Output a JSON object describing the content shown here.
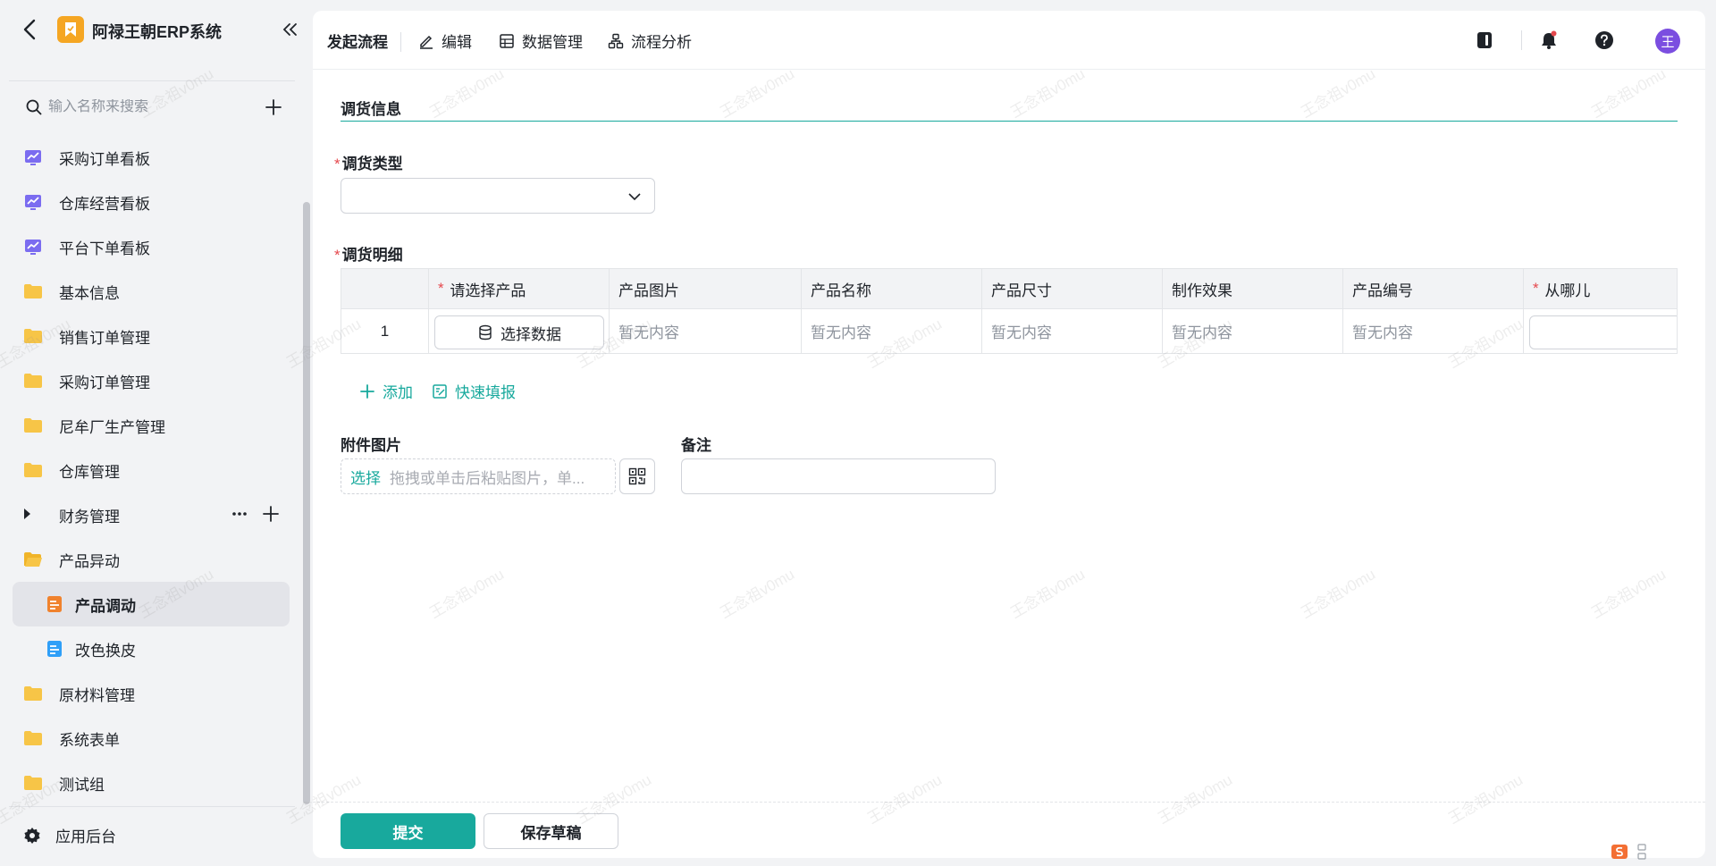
{
  "app": {
    "title": "阿禄王朝ERP系统"
  },
  "sidebar": {
    "search_placeholder": "输入名称来搜索",
    "items": [
      {
        "label": "采购订单看板",
        "icon": "dashboard-chart-icon"
      },
      {
        "label": "仓库经营看板",
        "icon": "dashboard-chart-icon"
      },
      {
        "label": "平台下单看板",
        "icon": "dashboard-chart-icon"
      },
      {
        "label": "基本信息",
        "icon": "folder-icon"
      },
      {
        "label": "销售订单管理",
        "icon": "folder-icon"
      },
      {
        "label": "采购订单管理",
        "icon": "folder-icon"
      },
      {
        "label": "尼牟厂生产管理",
        "icon": "folder-icon"
      },
      {
        "label": "仓库管理",
        "icon": "folder-icon"
      },
      {
        "label": "财务管理",
        "icon": "caret-right-icon"
      },
      {
        "label": "产品异动",
        "icon": "folder-open-icon"
      },
      {
        "label": "产品调动",
        "icon": "form-orange-icon"
      },
      {
        "label": "改色换皮",
        "icon": "form-blue-icon"
      },
      {
        "label": "原材料管理",
        "icon": "folder-icon"
      },
      {
        "label": "系统表单",
        "icon": "folder-icon"
      },
      {
        "label": "测试组",
        "icon": "folder-icon"
      }
    ],
    "footer_label": "应用后台"
  },
  "topbar": {
    "start_flow": "发起流程",
    "edit": "编辑",
    "data_manage": "数据管理",
    "flow_analysis": "流程分析",
    "avatar_text": "王"
  },
  "form": {
    "section_title": "调货信息",
    "transfer_type_label": "调货类型",
    "transfer_detail_label": "调货明细",
    "table": {
      "headers": [
        "请选择产品",
        "产品图片",
        "产品名称",
        "产品尺寸",
        "制作效果",
        "产品编号",
        "从哪儿"
      ],
      "row_index": "1",
      "pick_button": "选择数据",
      "empty": "暂无内容"
    },
    "add_label": "添加",
    "quick_fill_label": "快速填报",
    "attachment_label": "附件图片",
    "attachment_pick": "选择",
    "attachment_hint": "拖拽或单击后粘贴图片，单...",
    "remark_label": "备注"
  },
  "actions": {
    "submit": "提交",
    "save_draft": "保存草稿"
  },
  "watermark_text": "王念祖v0mu",
  "colors": {
    "accent": "#18a99d",
    "avatar": "#7b4ee0",
    "logo": "#f5a623"
  }
}
